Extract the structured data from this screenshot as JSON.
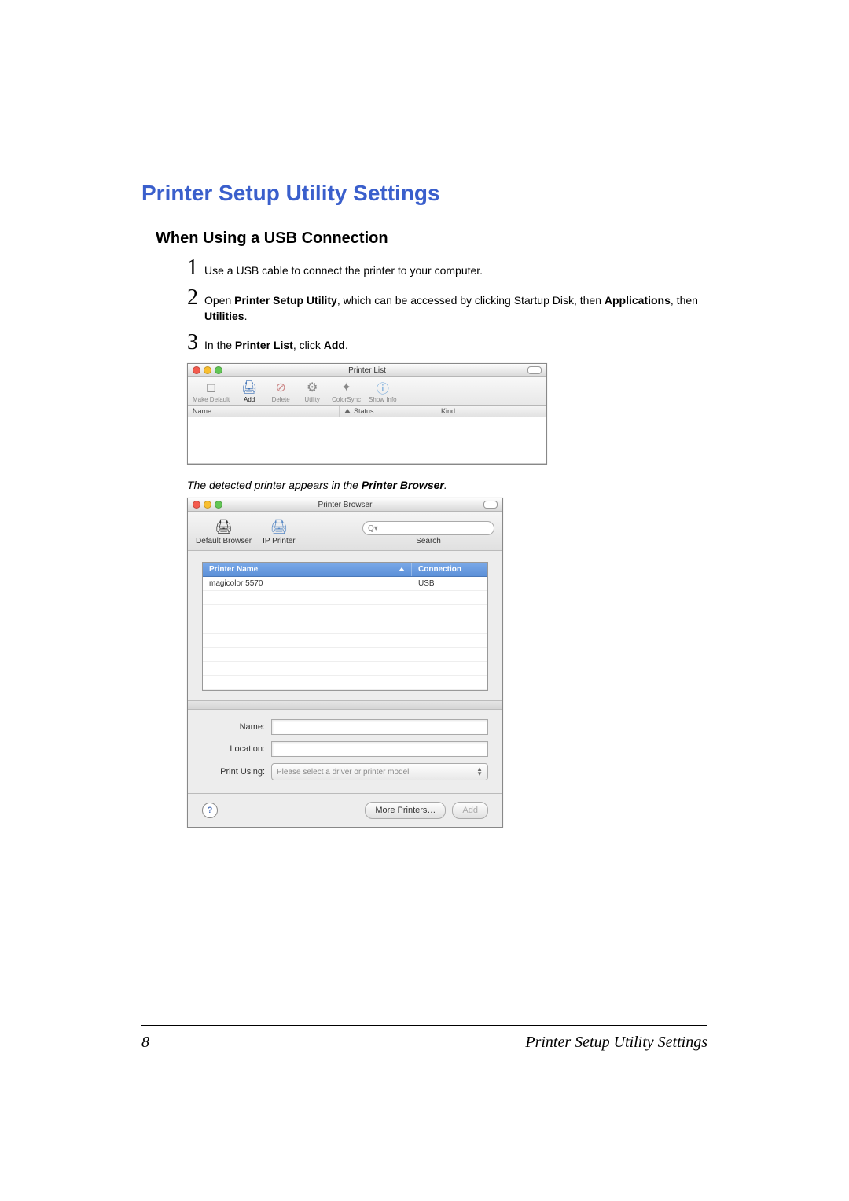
{
  "section_title": "Printer Setup Utility Settings",
  "subsection_title": "When Using a USB Connection",
  "steps": {
    "s1_num": "1",
    "s1_text": "Use a USB cable to connect the printer to your computer.",
    "s2_num": "2",
    "s2_prefix": "Open ",
    "s2_bold1": "Printer Setup Utility",
    "s2_mid": ", which can be accessed by clicking Startup Disk, then ",
    "s2_bold2": "Applications",
    "s2_mid2": ", then ",
    "s2_bold3": "Utilities",
    "s2_end": ".",
    "s3_num": "3",
    "s3_prefix": "In the ",
    "s3_bold1": "Printer List",
    "s3_mid": ", click ",
    "s3_bold2": "Add",
    "s3_end": "."
  },
  "printer_list": {
    "title": "Printer List",
    "tools": {
      "make_default": "Make Default",
      "add": "Add",
      "delete": "Delete",
      "utility": "Utility",
      "colorsync": "ColorSync",
      "show_info": "Show Info"
    },
    "cols": {
      "name": "Name",
      "status": "Status",
      "kind": "Kind"
    }
  },
  "caption": "The detected printer appears in the ",
  "caption_bold": "Printer Browser",
  "caption_end": ".",
  "browser": {
    "title": "Printer Browser",
    "tools": {
      "default": "Default Browser",
      "ip": "IP Printer",
      "search": "Search",
      "search_glyph": "Q▾"
    },
    "cols": {
      "name": "Printer Name",
      "conn": "Connection"
    },
    "row": {
      "name": "magicolor 5570",
      "conn": "USB"
    },
    "form": {
      "name": "Name:",
      "location": "Location:",
      "print_using": "Print Using:",
      "print_using_value": "Please select a driver or printer model"
    },
    "buttons": {
      "more": "More Printers…",
      "add": "Add"
    },
    "help": "?"
  },
  "footer": {
    "page": "8",
    "title": "Printer Setup Utility Settings"
  }
}
